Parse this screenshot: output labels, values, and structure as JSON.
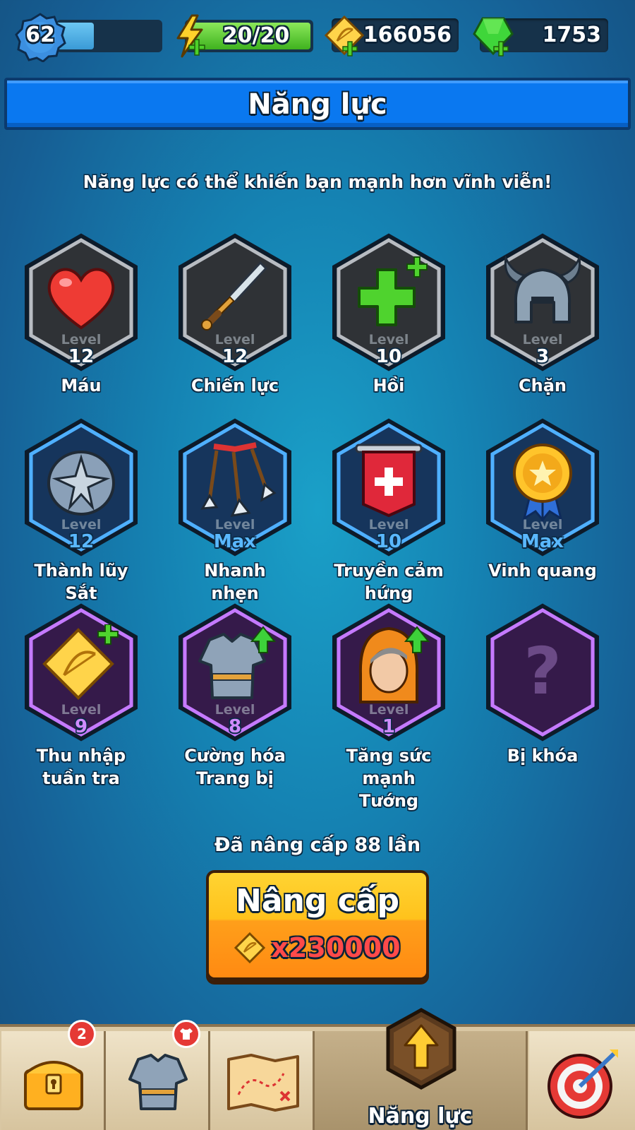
{
  "top_bar": {
    "player_level": "62",
    "xp_progress": 0.35,
    "energy": "20/20",
    "energy_progress": 1.0,
    "gold": "166056",
    "gems": "1753",
    "icons": {
      "level": "blue-gear-badge-icon",
      "energy": "lightning-plus-icon",
      "gold": "gold-bow-coin-plus-icon",
      "gems": "green-gem-plus-icon"
    }
  },
  "header": {
    "title": "Năng lực"
  },
  "subtitle": "Năng lực có thể khiến bạn mạnh hơn vĩnh viễn!",
  "level_label": "Level",
  "talents": [
    {
      "name": "Máu",
      "level": "12",
      "tier": "gray",
      "icon": "heart-icon"
    },
    {
      "name": "Chiến lực",
      "level": "12",
      "tier": "gray",
      "icon": "sword-icon"
    },
    {
      "name": "Hồi",
      "level": "10",
      "tier": "gray",
      "icon": "green-cross-plus-icon"
    },
    {
      "name": "Chặn",
      "level": "3",
      "tier": "gray",
      "icon": "horned-helmet-icon"
    },
    {
      "name": "Thành lũy Sắt",
      "level": "12",
      "tier": "blue",
      "icon": "spiked-shield-icon"
    },
    {
      "name": "Nhanh nhẹn",
      "level": "Max",
      "tier": "blue",
      "icon": "three-arrows-icon"
    },
    {
      "name": "Truyền cảm hứng",
      "level": "10",
      "tier": "blue",
      "icon": "red-banner-icon"
    },
    {
      "name": "Vinh quang",
      "level": "Max",
      "tier": "blue",
      "icon": "gold-medal-icon"
    },
    {
      "name": "Thu nhập tuần tra",
      "level": "9",
      "tier": "purple",
      "icon": "gold-coin-plus-icon"
    },
    {
      "name": "Cường hóa Trang bị",
      "level": "8",
      "tier": "purple",
      "icon": "armor-upgrade-icon"
    },
    {
      "name": "Tăng sức mạnh Tướng",
      "level": "1",
      "tier": "purple",
      "icon": "hooded-hero-upgrade-icon"
    },
    {
      "name": "Bị khóa",
      "level": "",
      "tier": "purple-locked",
      "icon": "question-mark-icon"
    }
  ],
  "upgrade": {
    "count_text": "Đã nâng cấp 88 lần",
    "button_label": "Nâng cấp",
    "cost": "x230000",
    "cost_icon": "gold-coin-icon"
  },
  "bottom_nav": {
    "items": [
      {
        "id": "chest",
        "icon": "treasure-chest-icon",
        "badge": "2",
        "label": ""
      },
      {
        "id": "equipment",
        "icon": "armor-icon",
        "badge_icon": "shirt-badge-icon",
        "label": ""
      },
      {
        "id": "map",
        "icon": "treasure-map-icon",
        "label": ""
      },
      {
        "id": "talents",
        "icon": "up-arrow-icon",
        "label": "Năng lực",
        "active": true
      },
      {
        "id": "battle",
        "icon": "target-arrow-icon",
        "label": ""
      }
    ]
  },
  "colors": {
    "background": "#1583b3",
    "header": "#0a78f0",
    "upgrade_button": "#ffb31f",
    "cost_text": "#ff4a4a",
    "tier_gray": "#3a3d42",
    "tier_blue": "#1b3e6a",
    "tier_purple": "#3e1f56"
  }
}
